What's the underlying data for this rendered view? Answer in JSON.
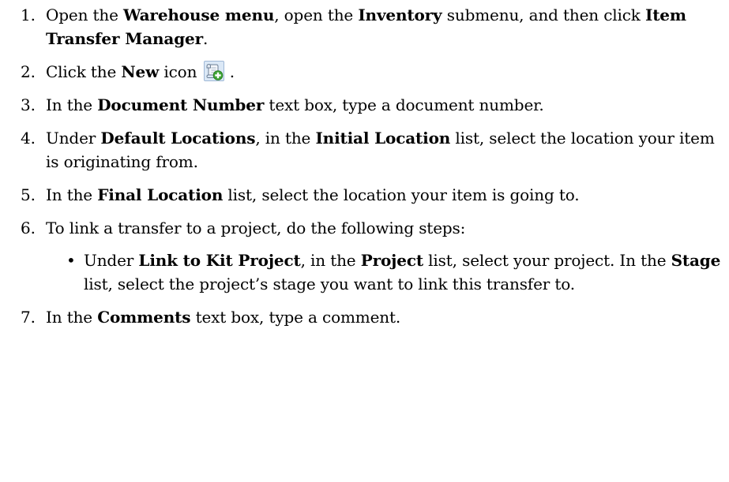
{
  "steps": [
    {
      "number": "1.",
      "parts": [
        {
          "t": "Open the "
        },
        {
          "t": "Warehouse menu",
          "b": true
        },
        {
          "t": ", open the "
        },
        {
          "t": "Inventory",
          "b": true
        },
        {
          "t": " submenu, and then click "
        },
        {
          "t": "Item Transfer Manager",
          "b": true
        },
        {
          "t": "."
        }
      ]
    },
    {
      "number": "2.",
      "parts": [
        {
          "t": "Click the "
        },
        {
          "t": "New",
          "b": true
        },
        {
          "t": " icon "
        },
        {
          "icon": "new-document-icon"
        },
        {
          "t": "."
        }
      ]
    },
    {
      "number": "3.",
      "parts": [
        {
          "t": "In the "
        },
        {
          "t": "Document Number",
          "b": true
        },
        {
          "t": " text box, type a document number."
        }
      ]
    },
    {
      "number": "4.",
      "parts": [
        {
          "t": "Under "
        },
        {
          "t": "Default Locations",
          "b": true
        },
        {
          "t": ", in the "
        },
        {
          "t": "Initial Location",
          "b": true
        },
        {
          "t": " list, select the location your item is originating from."
        }
      ]
    },
    {
      "number": "5.",
      "parts": [
        {
          "t": "In the "
        },
        {
          "t": "Final Location",
          "b": true
        },
        {
          "t": " list, select the location your item is going to."
        }
      ]
    },
    {
      "number": "6.",
      "parts": [
        {
          "t": "To link a transfer to a project, do the following steps:"
        }
      ],
      "substeps": [
        {
          "bullet": "•",
          "parts": [
            {
              "t": "Under "
            },
            {
              "t": "Link to Kit Project",
              "b": true
            },
            {
              "t": ", in the "
            },
            {
              "t": "Project",
              "b": true
            },
            {
              "t": " list, select your project. In the "
            },
            {
              "t": "Stage",
              "b": true
            },
            {
              "t": " list, select the project’s stage you want to link this transfer to."
            }
          ]
        }
      ]
    },
    {
      "number": "7.",
      "parts": [
        {
          "t": "In the "
        },
        {
          "t": "Comments",
          "b": true
        },
        {
          "t": " text box, type a comment."
        }
      ]
    }
  ]
}
